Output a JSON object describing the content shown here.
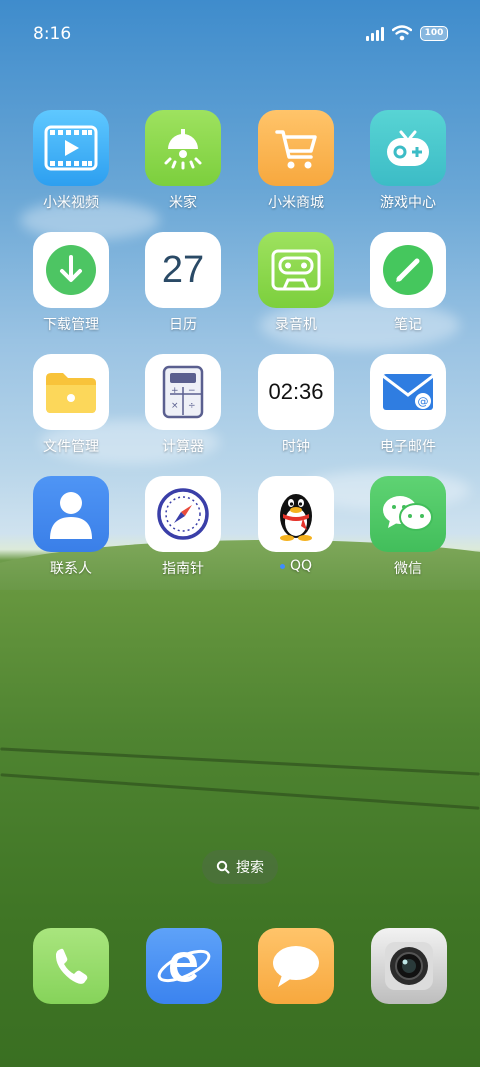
{
  "status_bar": {
    "time": "8:16",
    "battery": "100"
  },
  "apps": [
    {
      "label": "小米视频",
      "icon": "video-icon"
    },
    {
      "label": "米家",
      "icon": "lamp-icon"
    },
    {
      "label": "小米商城",
      "icon": "cart-icon"
    },
    {
      "label": "游戏中心",
      "icon": "gamepad-icon"
    },
    {
      "label": "下载管理",
      "icon": "download-icon"
    },
    {
      "label": "日历",
      "icon": "calendar-icon",
      "date": "27"
    },
    {
      "label": "录音机",
      "icon": "cassette-icon"
    },
    {
      "label": "笔记",
      "icon": "pencil-icon"
    },
    {
      "label": "文件管理",
      "icon": "folder-icon"
    },
    {
      "label": "计算器",
      "icon": "calculator-icon"
    },
    {
      "label": "时钟",
      "icon": "clock-icon",
      "clock_text": "02:36"
    },
    {
      "label": "电子邮件",
      "icon": "mail-icon"
    },
    {
      "label": "联系人",
      "icon": "contact-icon"
    },
    {
      "label": "指南针",
      "icon": "compass-icon"
    },
    {
      "label": "QQ",
      "icon": "penguin-icon",
      "new_indicator": true
    },
    {
      "label": "微信",
      "icon": "chat-bubbles-icon"
    }
  ],
  "search": {
    "label": "搜索",
    "icon": "search-icon"
  },
  "dock": [
    {
      "icon": "phone-icon"
    },
    {
      "icon": "browser-icon"
    },
    {
      "icon": "message-icon"
    },
    {
      "icon": "camera-icon"
    }
  ]
}
